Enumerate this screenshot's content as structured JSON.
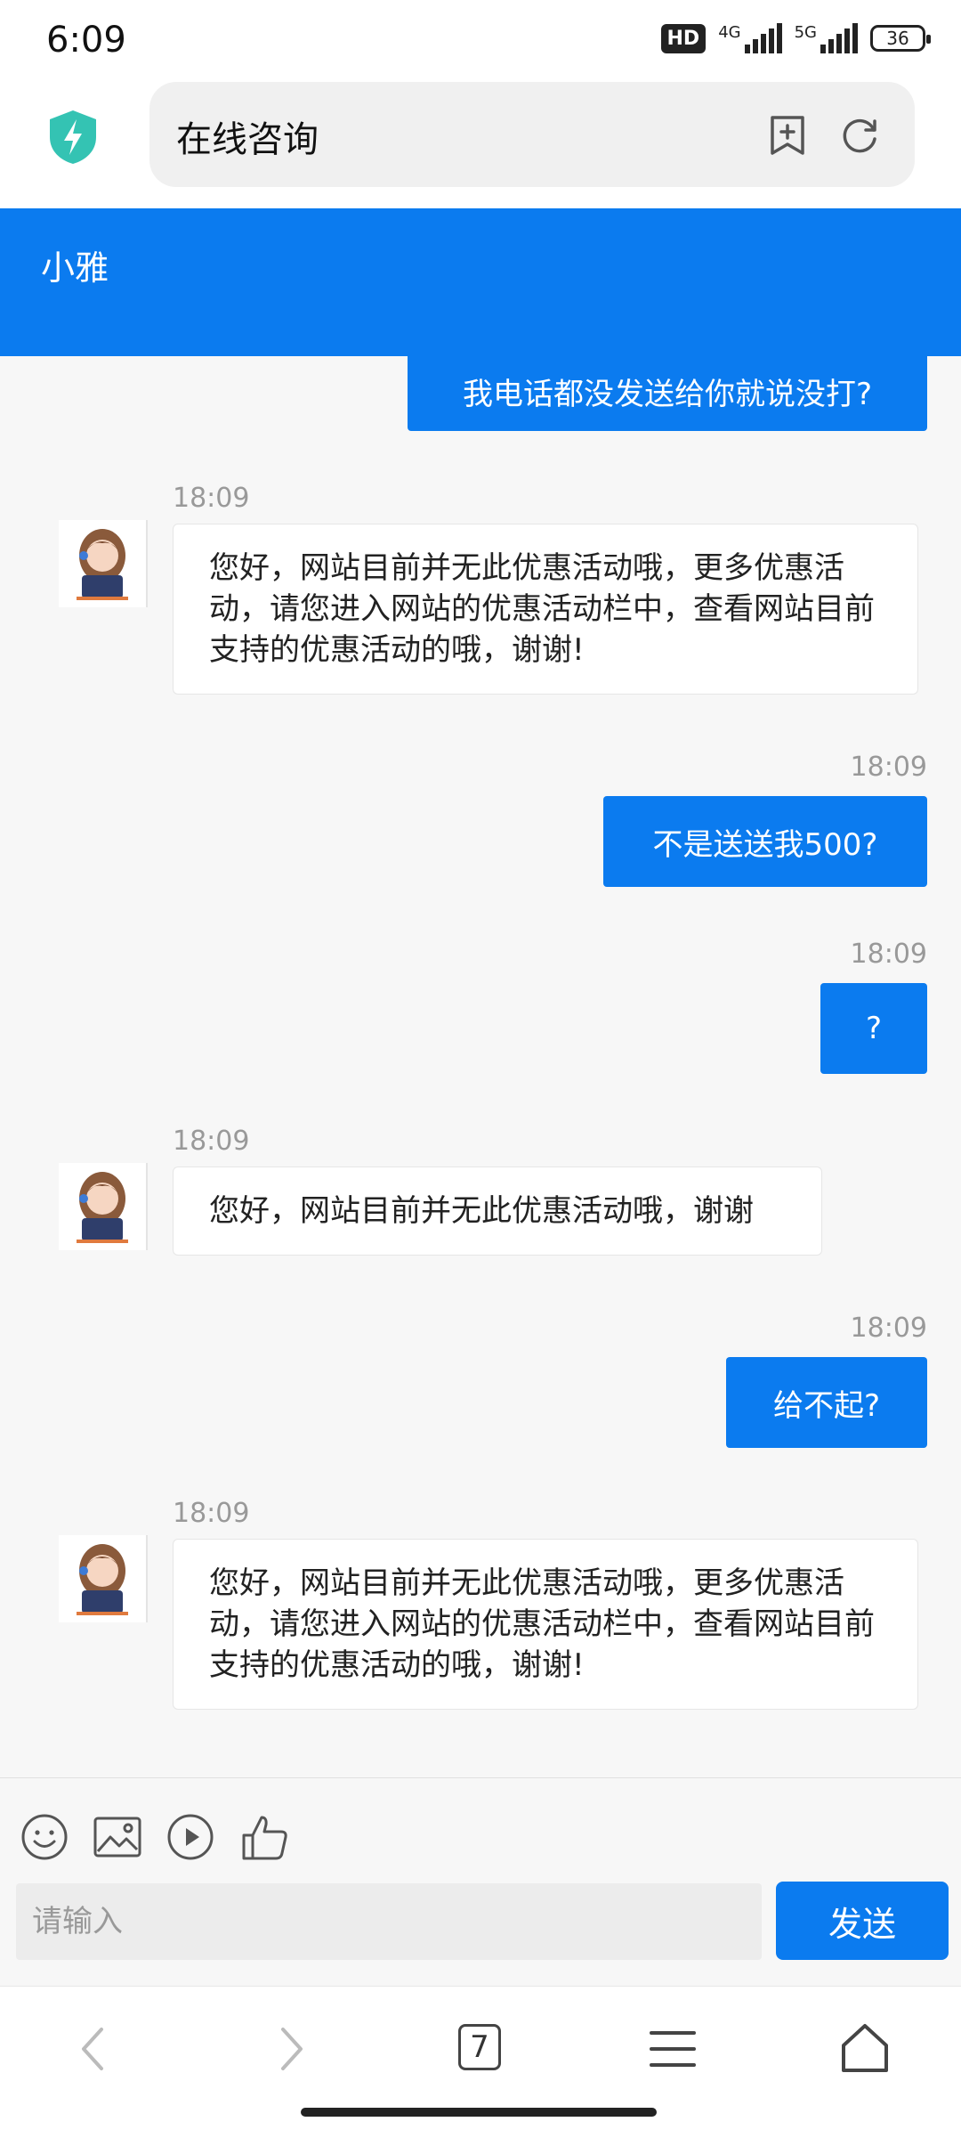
{
  "status_bar": {
    "time": "6:09",
    "hd": "HD",
    "net1": "4G",
    "net2": "5G",
    "battery": "36"
  },
  "browser": {
    "title": "在线咨询"
  },
  "chat": {
    "agent_name": "小雅",
    "input_placeholder": "请输入",
    "send_label": "发送",
    "messages": [
      {
        "from": "user",
        "text": "我电话都没发送给你就说没打?"
      },
      {
        "from": "agent",
        "time": "18:09",
        "text": "您好，网站目前并无此优惠活动哦，更多优惠活动，请您进入网站的优惠活动栏中，查看网站目前支持的优惠活动的哦，谢谢!"
      },
      {
        "from": "user",
        "time": "18:09",
        "text": "不是送送我500?"
      },
      {
        "from": "user",
        "time": "18:09",
        "text": "?"
      },
      {
        "from": "agent",
        "time": "18:09",
        "text": "您好，网站目前并无此优惠活动哦，谢谢"
      },
      {
        "from": "user",
        "time": "18:09",
        "text": "给不起?"
      },
      {
        "from": "agent",
        "time": "18:09",
        "text": "您好，网站目前并无此优惠活动哦，更多优惠活动，请您进入网站的优惠活动栏中，查看网站目前支持的优惠活动的哦，谢谢!"
      }
    ]
  },
  "nav": {
    "tab_count": "7"
  },
  "icons": [
    "shield-icon",
    "bookmark-add-icon",
    "reload-icon",
    "emoji-icon",
    "image-icon",
    "video-icon",
    "thumbs-up-icon",
    "back-icon",
    "forward-icon",
    "menu-icon",
    "home-icon"
  ],
  "colors": {
    "accent": "#0b7bef",
    "background": "#f7f7f7",
    "bubble_in": "#ffffff"
  }
}
